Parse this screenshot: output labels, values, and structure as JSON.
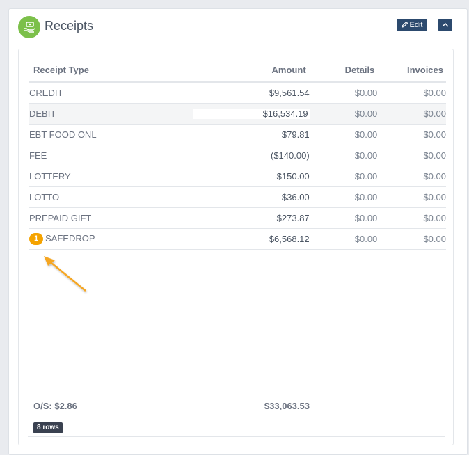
{
  "panel": {
    "title": "Receipts",
    "edit_label": "Edit",
    "icon": "cash-hand-icon",
    "accent": "#7cc04a",
    "button_color": "#2c4a6e"
  },
  "table": {
    "headers": [
      "Receipt Type",
      "Amount",
      "Details",
      "Invoices"
    ],
    "rows": [
      {
        "type": "CREDIT",
        "amount": "$9,561.54",
        "details": "$0.00",
        "invoices": "$0.00"
      },
      {
        "type": "DEBIT",
        "amount": "$16,534.19",
        "details": "$0.00",
        "invoices": "$0.00"
      },
      {
        "type": "EBT FOOD ONL",
        "amount": "$79.81",
        "details": "$0.00",
        "invoices": "$0.00"
      },
      {
        "type": "FEE",
        "amount": "($140.00)",
        "details": "$0.00",
        "invoices": "$0.00"
      },
      {
        "type": "LOTTERY",
        "amount": "$150.00",
        "details": "$0.00",
        "invoices": "$0.00"
      },
      {
        "type": "LOTTO",
        "amount": "$36.00",
        "details": "$0.00",
        "invoices": "$0.00"
      },
      {
        "type": "PREPAID GIFT",
        "amount": "$273.87",
        "details": "$0.00",
        "invoices": "$0.00"
      },
      {
        "type": "SAFEDROP",
        "amount": "$6,568.12",
        "details": "$0.00",
        "invoices": "$0.00"
      }
    ]
  },
  "annotation": {
    "badge": "1",
    "color": "#f5a300"
  },
  "footer": {
    "os_label": "O/S: $2.86",
    "total": "$33,063.53",
    "row_count": "8 rows"
  }
}
